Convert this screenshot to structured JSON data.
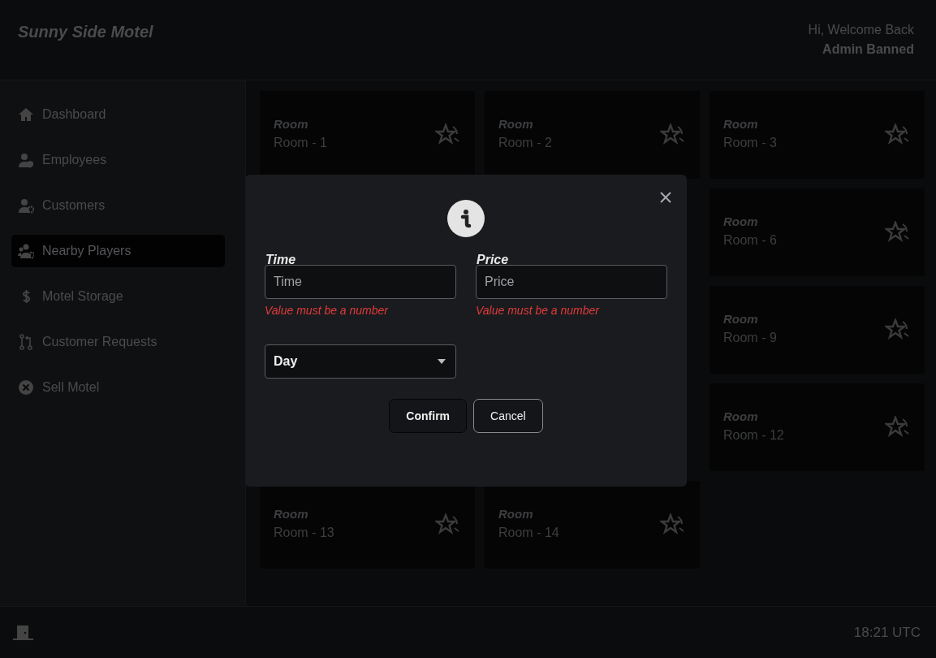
{
  "header": {
    "title": "Sunny Side Motel",
    "greeting": "Hi, Welcome Back",
    "user": "Admin Banned"
  },
  "sidebar": {
    "items": [
      {
        "label": "Dashboard",
        "selected": false
      },
      {
        "label": "Employees",
        "selected": false
      },
      {
        "label": "Customers",
        "selected": false
      },
      {
        "label": "Nearby Players",
        "selected": true
      },
      {
        "label": "Motel Storage",
        "selected": false
      },
      {
        "label": "Customer Requests",
        "selected": false
      },
      {
        "label": "Sell Motel",
        "selected": false
      }
    ]
  },
  "rooms": [
    {
      "heading": "Room",
      "name": "Room - 1"
    },
    {
      "heading": "Room",
      "name": "Room - 2"
    },
    {
      "heading": "Room",
      "name": "Room - 3"
    },
    {
      "heading": "Room",
      "name": "Room - 6"
    },
    {
      "heading": "Room",
      "name": "Room - 9"
    },
    {
      "heading": "Room",
      "name": "Room - 12"
    },
    {
      "heading": "Room",
      "name": "Room - 13"
    },
    {
      "heading": "Room",
      "name": "Room - 14"
    }
  ],
  "dialog": {
    "fields": [
      {
        "label": "Time",
        "placeholder": "Time",
        "error": "Value must be a number"
      },
      {
        "label": "Price",
        "placeholder": "Price",
        "error": "Value must be a number"
      }
    ],
    "select": {
      "value": "Day"
    },
    "buttons": [
      {
        "label": "Confirm",
        "kind": "primary"
      },
      {
        "label": "Cancel",
        "kind": "secondary"
      }
    ]
  },
  "footer": {
    "time": "18:21 UTC"
  }
}
